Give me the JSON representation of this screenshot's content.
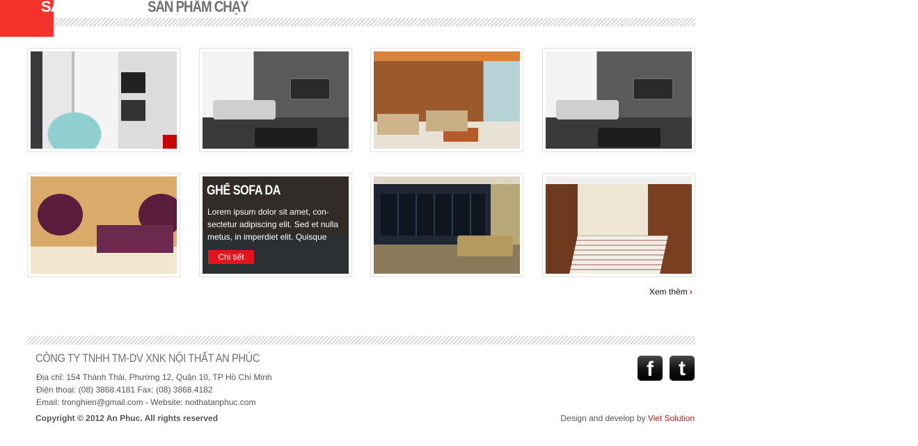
{
  "header": {
    "tab_label": "SẢ",
    "section_title": "SẢN PHẨM CHẠY"
  },
  "products": {
    "featured": {
      "title": "GHẾ SOFA DA",
      "description": "Lorem ipsum dolor sit amet, con-sectetur adipiscing elit. Sed et nulla metus, in imperdiet elit. Quisque",
      "button_label": "Chi tiết"
    },
    "more_label": "Xem thêm",
    "more_arrow": "›"
  },
  "footer": {
    "company": "CÔNG TY TNHH TM-DV XNK NỘI THẤT AN PHÚC",
    "address": "Địa chỉ: 154 Thành Thái, Phường 12, Quận 10, TP Hồ Chí Minh",
    "phone": "Điện thoại: (08) 3868.4181   Fax: (08) 3868.4182",
    "email": "Email: tronghien@gmail.com - Website: noithatanphuc.com",
    "copyright": "Copyright © 2012 An Phuc. All rights reserved",
    "design_prefix": "Design and develop by ",
    "design_company": "Viet Solution",
    "facebook_glyph": "f",
    "twitter_glyph": "t"
  },
  "colors": {
    "accent": "#f2322b",
    "button": "#e3141d",
    "link": "#c31b1b"
  }
}
